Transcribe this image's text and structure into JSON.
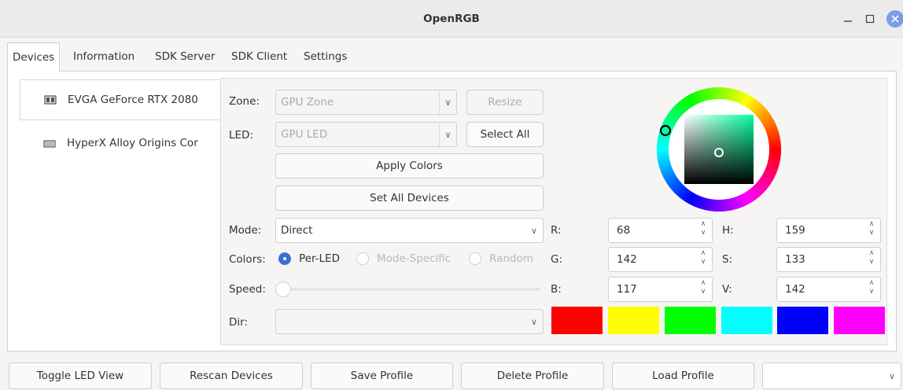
{
  "window": {
    "title": "OpenRGB"
  },
  "tabs": [
    {
      "label": "Devices",
      "active": true
    },
    {
      "label": "Information"
    },
    {
      "label": "SDK Server"
    },
    {
      "label": "SDK Client"
    },
    {
      "label": "Settings"
    }
  ],
  "devices": [
    {
      "name": "EVGA GeForce RTX 2080",
      "icon": "gpu-icon",
      "selected": true
    },
    {
      "name": "HyperX Alloy Origins Cor",
      "icon": "keyboard-icon"
    }
  ],
  "controls": {
    "zone_label": "Zone:",
    "zone_value": "GPU Zone",
    "resize_label": "Resize",
    "led_label": "LED:",
    "led_value": "GPU LED",
    "select_all_label": "Select All",
    "apply_colors_label": "Apply Colors",
    "set_all_devices_label": "Set All Devices",
    "mode_label": "Mode:",
    "mode_value": "Direct",
    "colors_label": "Colors:",
    "color_modes": [
      "Per-LED",
      "Mode-Specific",
      "Random"
    ],
    "speed_label": "Speed:",
    "dir_label": "Dir:"
  },
  "color": {
    "r_label": "R:",
    "r": "68",
    "g_label": "G:",
    "g": "142",
    "b_label": "B:",
    "b": "117",
    "h_label": "H:",
    "h": "159",
    "s_label": "S:",
    "s": "133",
    "v_label": "V:",
    "v": "142",
    "current_hex": "#448e75"
  },
  "swatches": [
    "#ff0000",
    "#ffff00",
    "#00ff00",
    "#00ffff",
    "#0000ff",
    "#ff00ff"
  ],
  "bottom_bar": {
    "toggle_led_view": "Toggle LED View",
    "rescan_devices": "Rescan Devices",
    "save_profile": "Save Profile",
    "delete_profile": "Delete Profile",
    "load_profile": "Load Profile",
    "profile_value": ""
  }
}
